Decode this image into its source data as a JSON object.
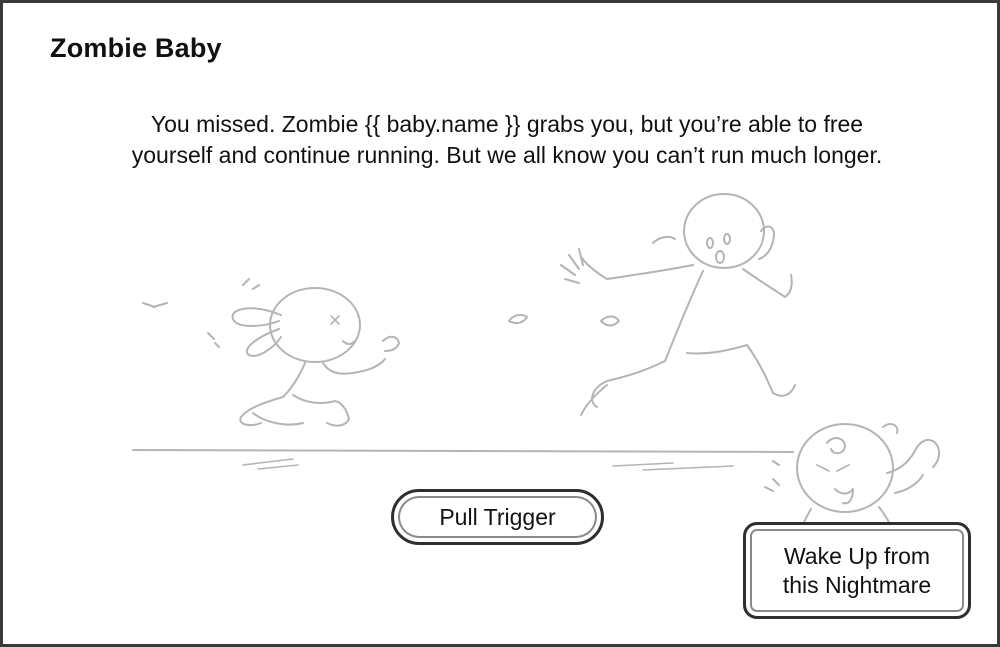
{
  "game": {
    "title": "Zombie Baby",
    "narration": {
      "line1": "You missed.  Zombie {{ baby.name }} grabs you, but you’re able to free",
      "line2": "yourself and continue running.  But we all know you can’t run much longer."
    },
    "choices": {
      "pull_trigger": "Pull Trigger",
      "wake_up_line1": "Wake Up from",
      "wake_up_line2": "this Nightmare"
    }
  },
  "colors": {
    "frame": "#3a3a3a",
    "sketch": "#b4b4b4",
    "text": "#111111"
  }
}
